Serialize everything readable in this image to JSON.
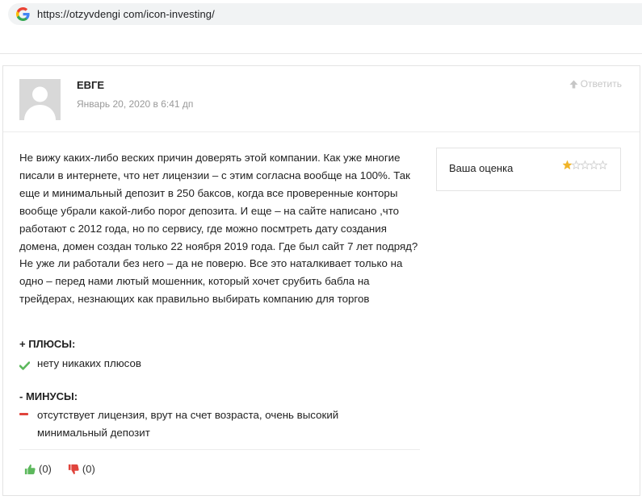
{
  "browser": {
    "url": "https://otzyvdengi com/icon-investing/"
  },
  "comment": {
    "author": "ЕВГЕ",
    "date": "Январь 20, 2020 в 6:41 дп",
    "reply_label": "Ответить",
    "text": "Не вижу каких-либо веских причин доверять этой компании. Как уже многие писали в интернете, что нет лицензии – с этим согласна вообще на 100%. Так еще и минимальный депозит в 250 баксов, когда все проверенные конторы вообще убрали какой-либо порог депозита. И еще – на сайте написано ,что работают с 2012 года, но по сервису, где можно посмтреть дату создания домена, домен создан только 22 ноября 2019 года. Где был сайт 7 лет подряд? Не уже ли работали без него – да не поверю. Все это наталкивает только на одно – перед нами лютый мошенник, который хочет срубить бабла на трейдерах, незнающих как правильно выбирать компанию для торгов",
    "rating": {
      "label": "Ваша оценка",
      "value": 1,
      "max": 5,
      "star_color": "#f0b429",
      "empty_color": "#cfcfcf"
    },
    "pros": {
      "title": "+ ПЛЮСЫ:",
      "text": "нету никаких плюсов",
      "icon": "check-icon",
      "color": "#5cb85c"
    },
    "cons": {
      "title": "- МИНУСЫ:",
      "text": "отсутствует лицензия, врут на счет возраста, очень высокий минимальный депозит",
      "icon": "minus-icon",
      "color": "#e0443c"
    },
    "votes": {
      "up": "(0)",
      "down": "(0)",
      "up_color": "#5cb85c",
      "down_color": "#e0443c"
    }
  }
}
